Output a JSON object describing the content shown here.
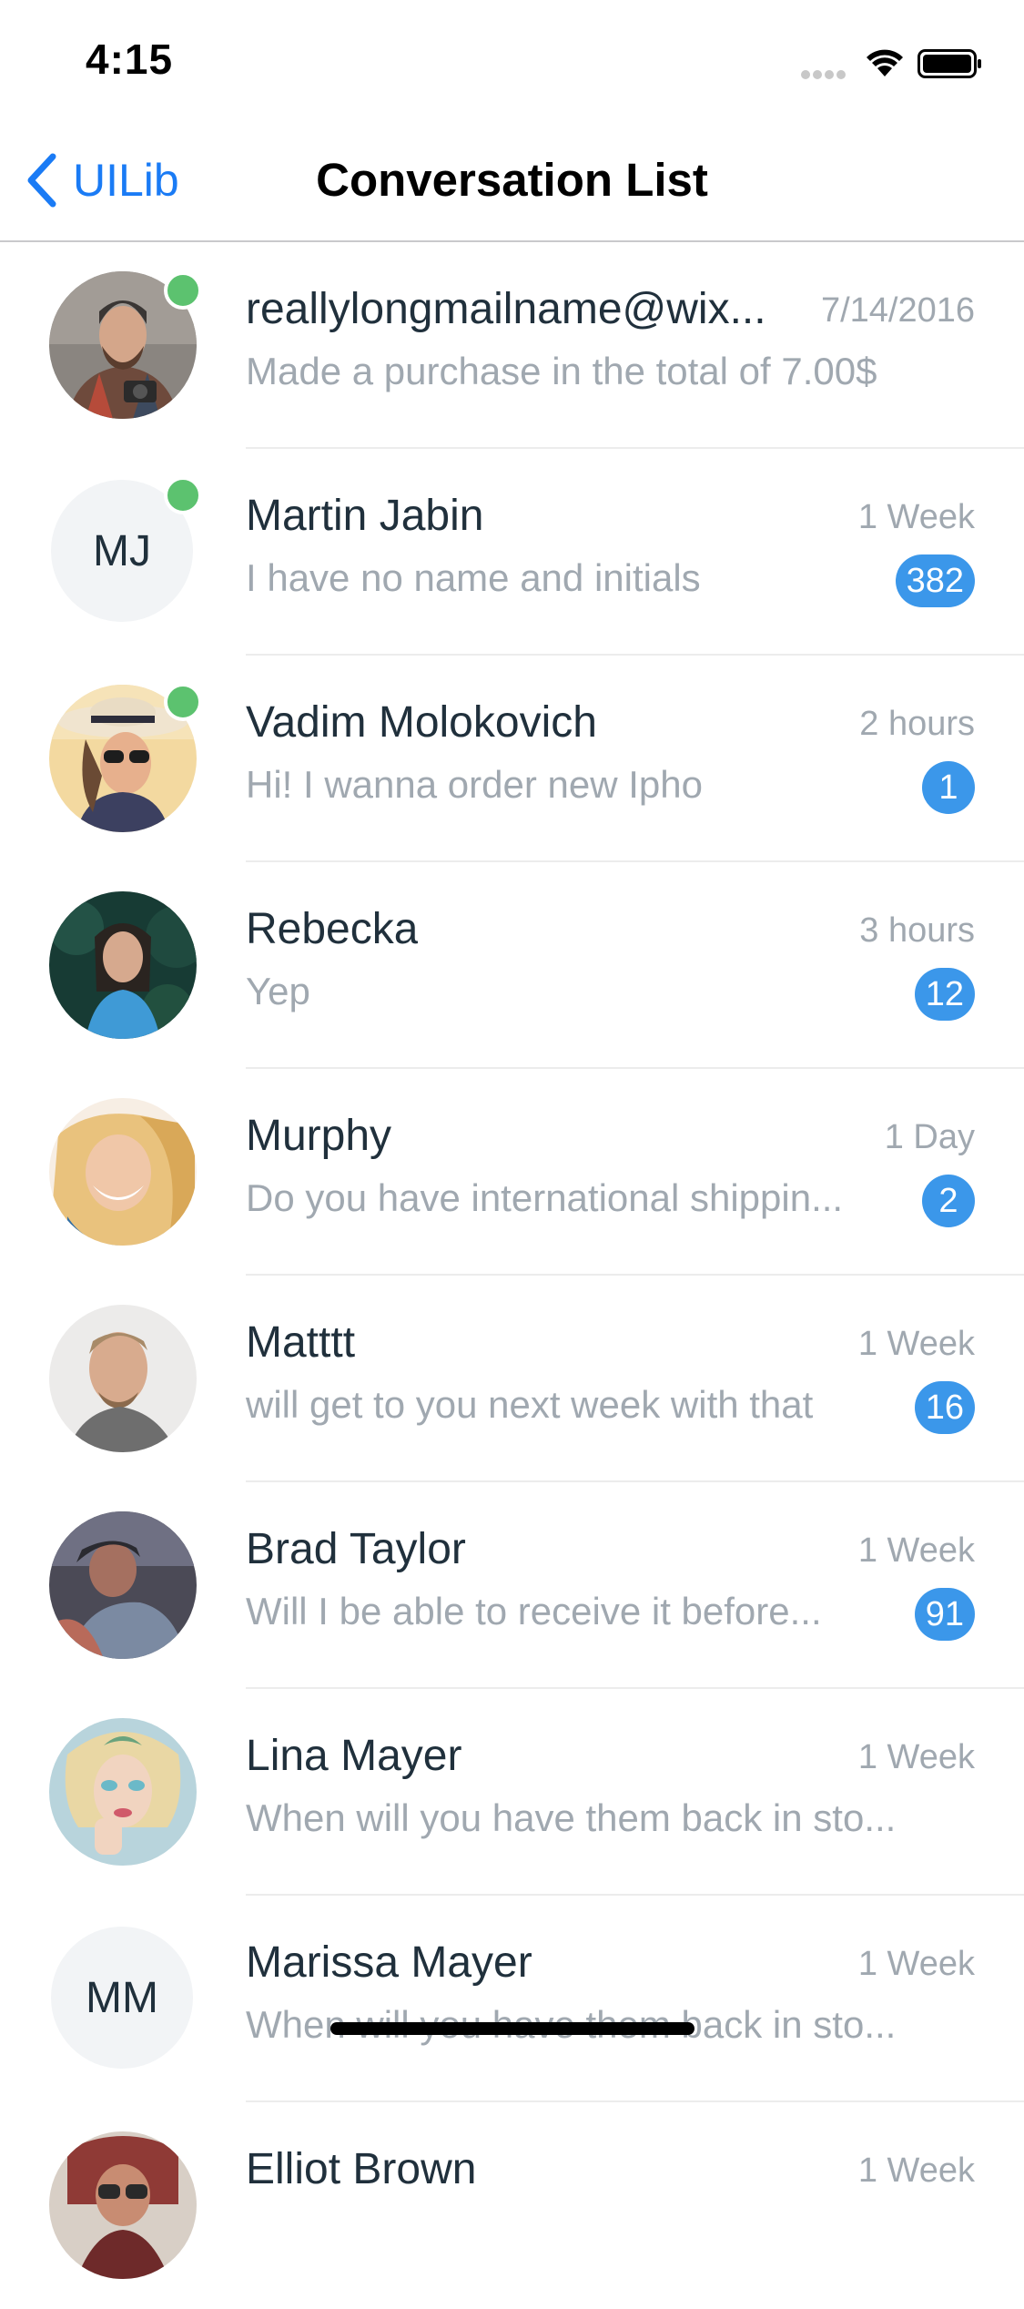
{
  "status_bar": {
    "time": "4:15"
  },
  "nav": {
    "back_label": "UILib",
    "title": "Conversation List"
  },
  "conversations": [
    {
      "name": "reallylongmailname@wix...",
      "time": "7/14/2016",
      "message": "Made a purchase in the total of 7.00$",
      "badge": "",
      "online": true,
      "avatar": "photo"
    },
    {
      "name": "Martin Jabin",
      "time": "1 Week",
      "message": "I have no name and initials",
      "badge": "382",
      "online": true,
      "initials": "MJ"
    },
    {
      "name": "Vadim Molokovich",
      "time": "2 hours",
      "message": "Hi! I wanna order new Ipho",
      "badge": "1",
      "online": true,
      "avatar": "photo"
    },
    {
      "name": "Rebecka",
      "time": "3 hours",
      "message": "Yep",
      "badge": "12",
      "online": false,
      "avatar": "photo"
    },
    {
      "name": "Murphy",
      "time": "1 Day",
      "message": "Do you have international shippin...",
      "badge": "2",
      "online": false,
      "avatar": "photo"
    },
    {
      "name": "Matttt",
      "time": "1 Week",
      "message": "will get to you next week with that",
      "badge": "16",
      "online": false,
      "avatar": "photo"
    },
    {
      "name": "Brad Taylor",
      "time": "1 Week",
      "message": "Will I be able to receive it before...",
      "badge": "91",
      "online": false,
      "avatar": "photo"
    },
    {
      "name": "Lina Mayer",
      "time": "1 Week",
      "message": "When will you have them back in sto...",
      "badge": "",
      "online": false,
      "avatar": "photo"
    },
    {
      "name": "Marissa Mayer",
      "time": "1 Week",
      "message": "When will you have them back in sto...",
      "badge": "",
      "online": false,
      "initials": "MM"
    },
    {
      "name": "Elliot Brown",
      "time": "1 Week",
      "message": "",
      "badge": "",
      "online": false,
      "avatar": "photo"
    }
  ],
  "colors": {
    "accent": "#1a7bf5",
    "badge": "#3b97ea",
    "online": "#5cc26f"
  }
}
